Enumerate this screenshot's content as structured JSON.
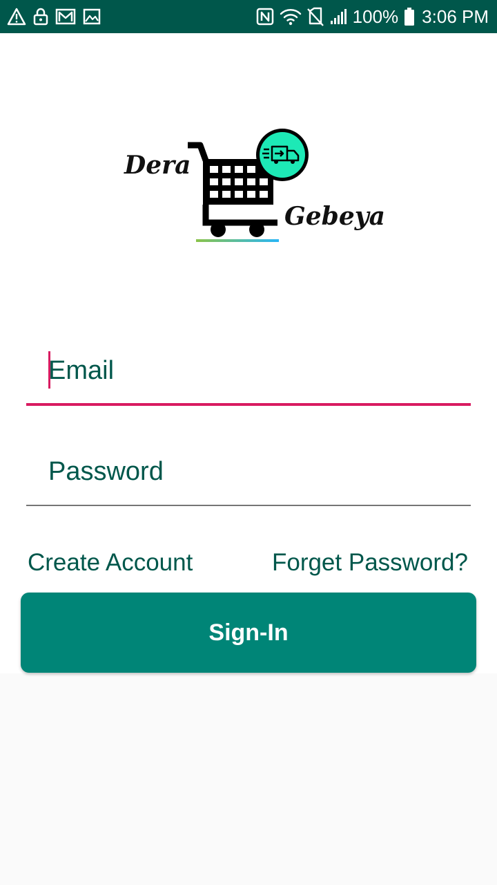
{
  "status_bar": {
    "icons_left": [
      "warning-icon",
      "lock-icon",
      "gmail-icon",
      "image-icon"
    ],
    "icons_right": [
      "nfc-icon",
      "wifi-icon",
      "no-sim-icon",
      "signal-icon"
    ],
    "battery": "100%",
    "time": "3:06 PM",
    "background": "#00574B"
  },
  "logo": {
    "word1": "Dera",
    "word2": "Gebeya",
    "badge_color": "#1DE9B6"
  },
  "form": {
    "email_placeholder": "Email",
    "password_placeholder": "Password",
    "create_account": "Create Account",
    "forget_password": "Forget Password?",
    "signin_label": "Sign-In"
  },
  "colors": {
    "primary_dark": "#00574B",
    "primary": "#008577",
    "accent": "#D81B60"
  }
}
